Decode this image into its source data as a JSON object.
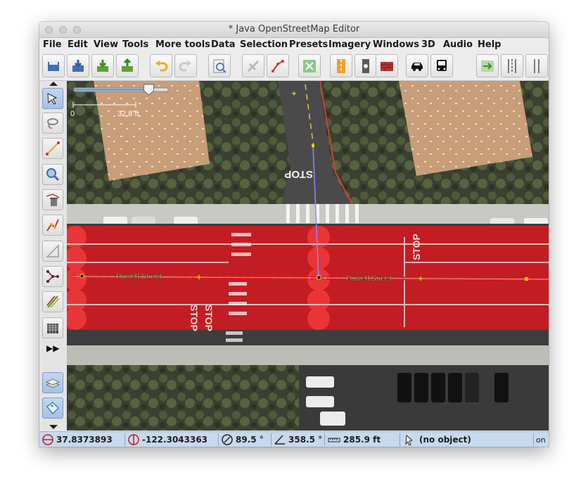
{
  "window": {
    "title": "* Java OpenStreetMap Editor"
  },
  "menu": [
    "File",
    "Edit",
    "View",
    "Tools",
    "More tools",
    "Data",
    "Selection",
    "Presets",
    "Imagery",
    "Windows",
    "3D",
    "Audio",
    "Help"
  ],
  "toolbar_icons": [
    "open-file-icon",
    "download-icon",
    "upload-icon",
    "upload-green-icon",
    "undo-icon",
    "redo-icon",
    "zoom-preferences-icon",
    "satellite-icon",
    "wireframe-icon",
    "fit-icon",
    "road-icon",
    "traffic-signal-icon",
    "barrier-icon",
    "car-icon",
    "bus-icon",
    "split-icon",
    "lane-icon",
    "parallel-lines-icon"
  ],
  "sidebar_icons": [
    "select-tool-icon",
    "lasso-icon",
    "draw-icon",
    "zoom-tool-icon",
    "delete-tool-icon",
    "improve-way-icon",
    "parallel-icon",
    "node-graph-icon",
    "color-line-icon",
    "buildings-icon",
    "layers-icon",
    "tags-icon"
  ],
  "sidebar_more": "▶▶",
  "map": {
    "scale_start": "0",
    "scale_label": "32.8 ft",
    "zoom_fraction": 0.8,
    "street_names": [
      "Powell Street",
      "Powell Street"
    ],
    "road_markings": [
      "STOP",
      "STOP",
      "STOP",
      "STOP"
    ]
  },
  "status": {
    "lat": "37.8373893",
    "lon": "-122.3043363",
    "heading": "89.5 °",
    "angle": "358.5 °",
    "distance": "285.9 ft",
    "object": "(no object)",
    "extra": "on"
  },
  "colors": {
    "overlay_red": "#e8141c",
    "status_bg": "#c7d9ee",
    "selection_line": "#8a8aff"
  }
}
